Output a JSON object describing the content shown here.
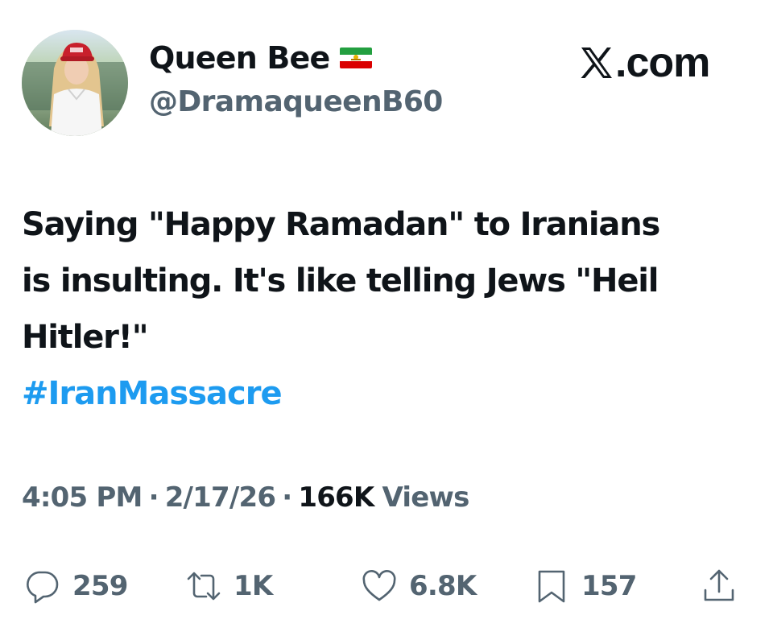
{
  "author": {
    "display_name": "Queen Bee",
    "handle": "@DramaqueenB60",
    "flag_icon": "iran-lion-and-sun-flag-icon"
  },
  "site_badge": {
    "label": ".com",
    "logo_icon": "x-logo-icon"
  },
  "tweet": {
    "text": "Saying \"Happy Ramadan\" to Iranians\nis insulting. It's like telling Jews \"Heil\nHitler!\"",
    "hashtag": "#IranMassacre"
  },
  "meta": {
    "time": "4:05 PM",
    "separator": "·",
    "date": "2/17/26",
    "views_count": "166K",
    "views_label": "Views"
  },
  "actions": {
    "replies": {
      "icon": "reply-icon",
      "count": "259"
    },
    "retweets": {
      "icon": "retweet-icon",
      "count": "1K"
    },
    "likes": {
      "icon": "heart-icon",
      "count": "6.8K"
    },
    "bookmarks": {
      "icon": "bookmark-icon",
      "count": "157"
    },
    "share": {
      "icon": "share-icon"
    }
  },
  "colors": {
    "text_primary": "#0f1419",
    "text_secondary": "#536471",
    "link_blue": "#1d9bf0",
    "background": "#ffffff"
  }
}
